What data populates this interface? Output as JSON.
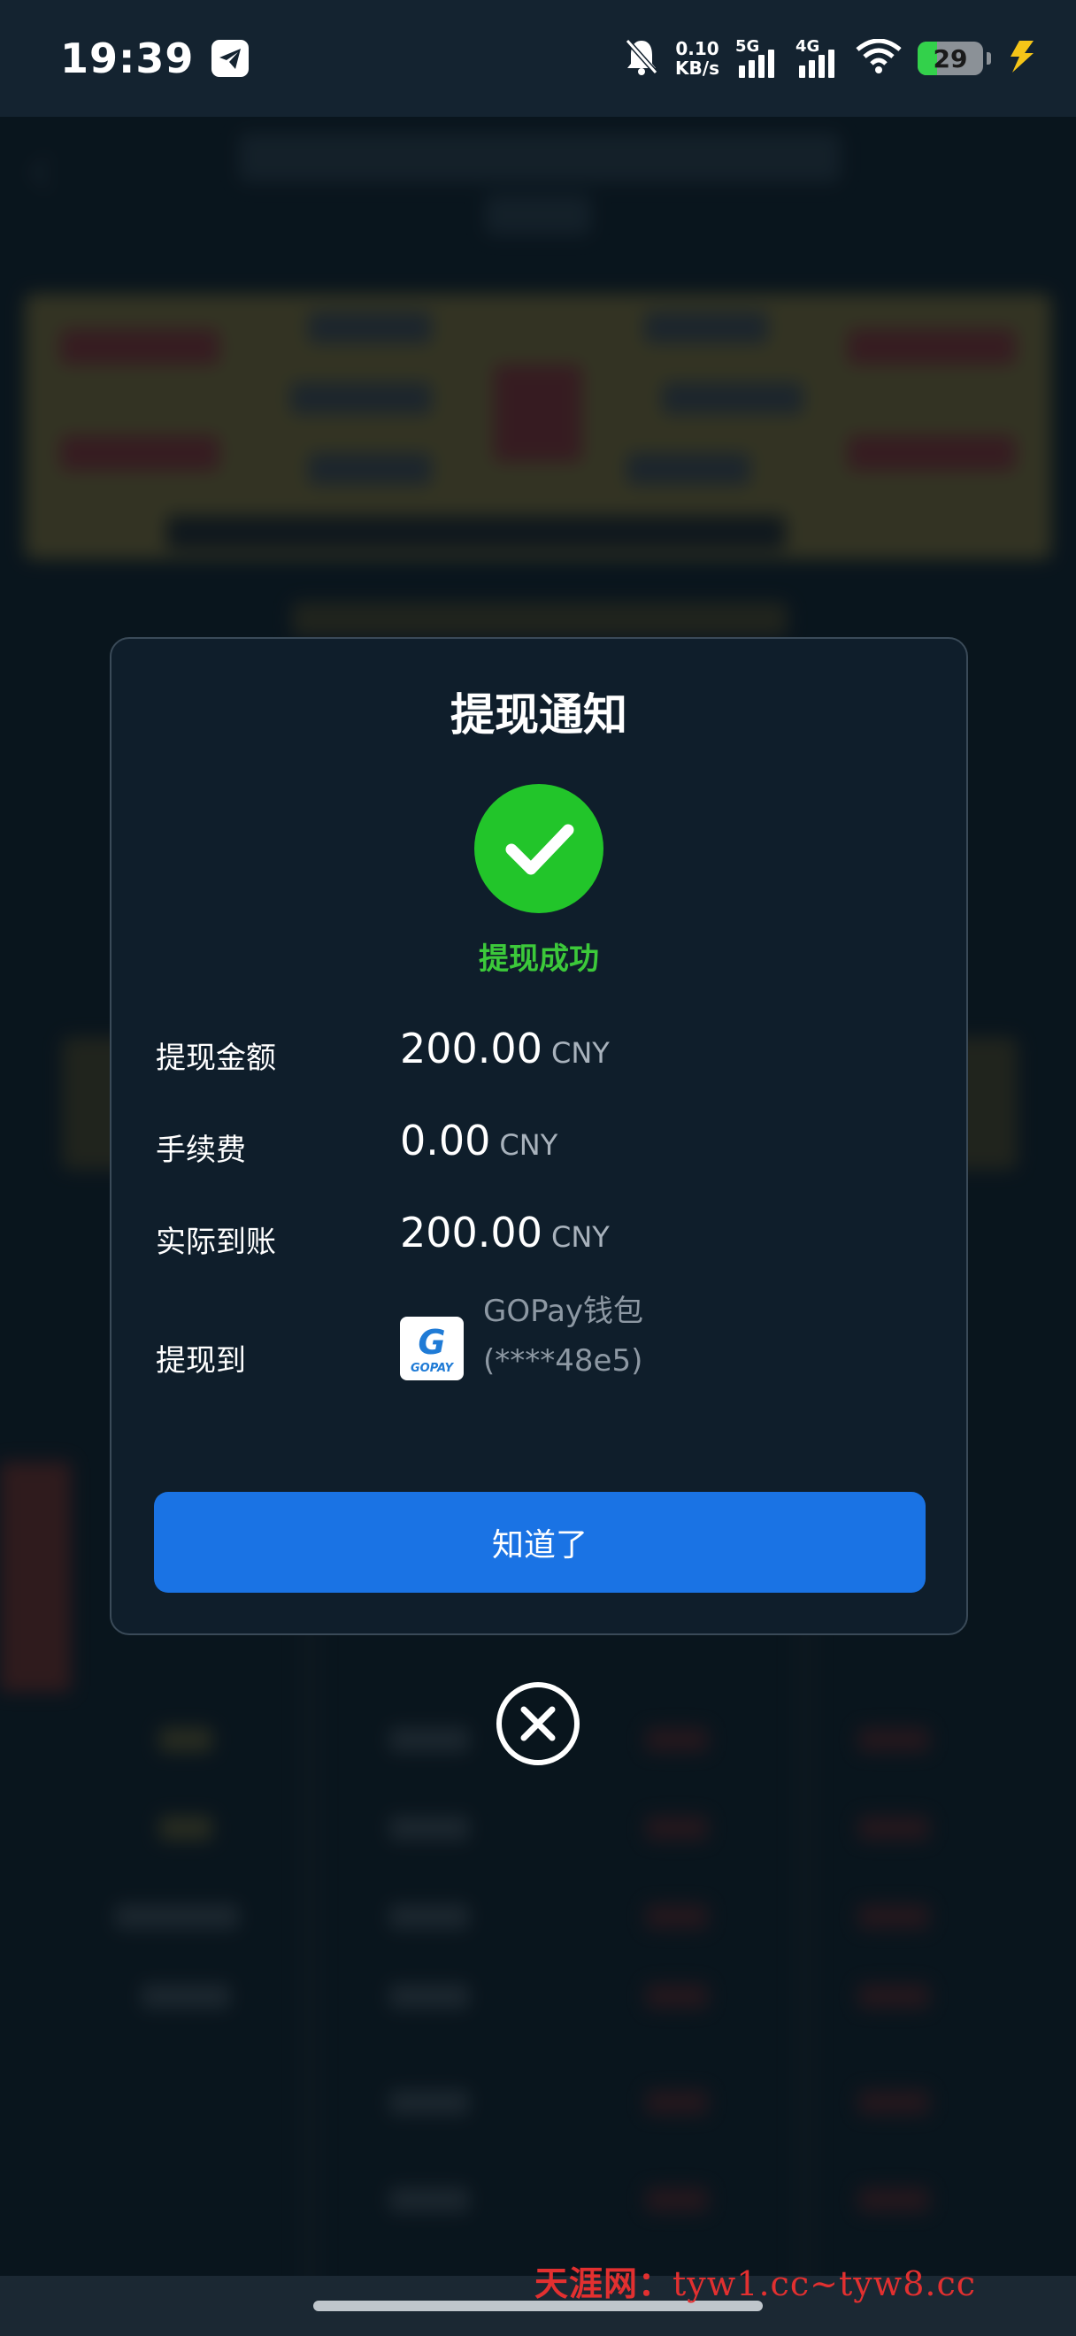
{
  "status_bar": {
    "time": "19:39",
    "net_speed_value": "0.10",
    "net_speed_unit": "KB/s",
    "signal_1_label": "5G",
    "signal_2_label": "4G",
    "battery_level": "29",
    "icons": [
      "telegram-icon",
      "mute-bell-icon",
      "signal-icon",
      "wifi-icon",
      "battery-icon",
      "charging-bolt-icon"
    ]
  },
  "dialog": {
    "title": "提现通知",
    "status_text": "提现成功",
    "rows": {
      "amount": {
        "label": "提现金额",
        "value": "200.00",
        "unit": "CNY"
      },
      "fee": {
        "label": "手续费",
        "value": "0.00",
        "unit": "CNY"
      },
      "actual": {
        "label": "实际到账",
        "value": "200.00",
        "unit": "CNY"
      }
    },
    "destination": {
      "label": "提现到",
      "wallet_name": "GOPay钱包",
      "account_mask": "(****48e5)",
      "logo_letter": "G",
      "logo_text": "GOPAY"
    },
    "confirm_label": "知道了"
  },
  "watermark": {
    "site": "天涯网：",
    "urls": "tyw1.cc~tyw8.cc"
  },
  "colors": {
    "accent_blue": "#1a73e4",
    "success_green": "#22c52a",
    "dialog_bg": "#0f1e2b",
    "watermark_red": "#e23030"
  }
}
